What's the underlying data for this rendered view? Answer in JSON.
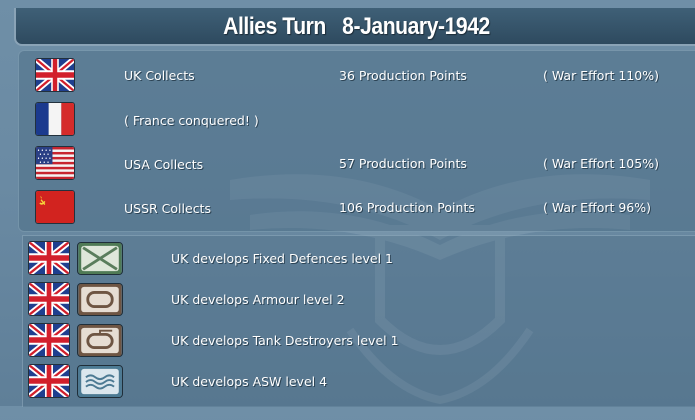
{
  "header": {
    "title": "Allies Turn   8-January-1942"
  },
  "collections": [
    {
      "flag": "uk-flag",
      "label": "UK Collects",
      "points": "36 Production Points",
      "effort": "( War Effort 110%)"
    },
    {
      "flag": "france-flag",
      "label": "( France conquered! )",
      "points": "",
      "effort": ""
    },
    {
      "flag": "usa-flag",
      "label": "USA Collects",
      "points": "57 Production Points",
      "effort": "( War Effort 105%)"
    },
    {
      "flag": "ussr-flag",
      "label": "USSR Collects",
      "points": "106 Production Points",
      "effort": "( War Effort 96%)"
    }
  ],
  "developments": [
    {
      "flag": "uk-flag",
      "icon": "fixed-defences-icon",
      "text": "UK develops Fixed Defences level 1"
    },
    {
      "flag": "uk-flag",
      "icon": "armour-icon",
      "text": "UK develops Armour level 2"
    },
    {
      "flag": "uk-flag",
      "icon": "tank-destroyers-icon",
      "text": "UK develops Tank Destroyers level 1"
    },
    {
      "flag": "uk-flag",
      "icon": "asw-icon",
      "text": "UK develops ASW level 4"
    }
  ],
  "colors": {
    "fixed_defences": "#4f7a55",
    "armour": "#6e5543",
    "asw": "#4c7a93"
  }
}
